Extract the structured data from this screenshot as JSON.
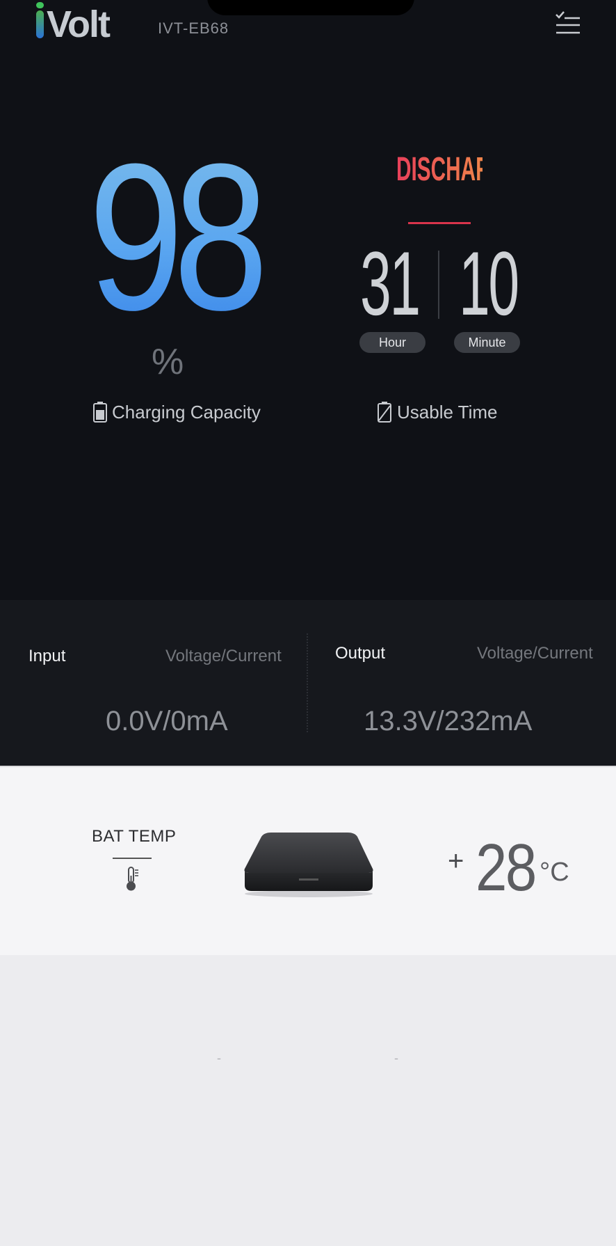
{
  "header": {
    "logo_text": "Volt",
    "model": "IVT-EB68",
    "menu_icon": "checklist-menu-icon"
  },
  "battery": {
    "percent": "98",
    "percent_sign": "%",
    "label": "Charging Capacity"
  },
  "usable": {
    "status": "DISCHARGING",
    "hours": "31",
    "minutes": "10",
    "hour_label": "Hour",
    "minute_label": "Minute",
    "label": "Usable Time"
  },
  "io": {
    "input": {
      "title": "Input",
      "subtitle": "Voltage/Current",
      "value": "0.0V/0mA"
    },
    "output": {
      "title": "Output",
      "subtitle": "Voltage/Current",
      "value": "13.3V/232mA"
    }
  },
  "temperature": {
    "title": "BAT TEMP",
    "sign": "+",
    "value": "28",
    "unit": "°C"
  },
  "footer": {
    "dash_left": "-",
    "dash_right": "-"
  },
  "colors": {
    "accent_blue": "#3a86e9",
    "status_red": "#e8405a",
    "status_orange": "#f0844a",
    "dark_bg": "#0f1116"
  }
}
